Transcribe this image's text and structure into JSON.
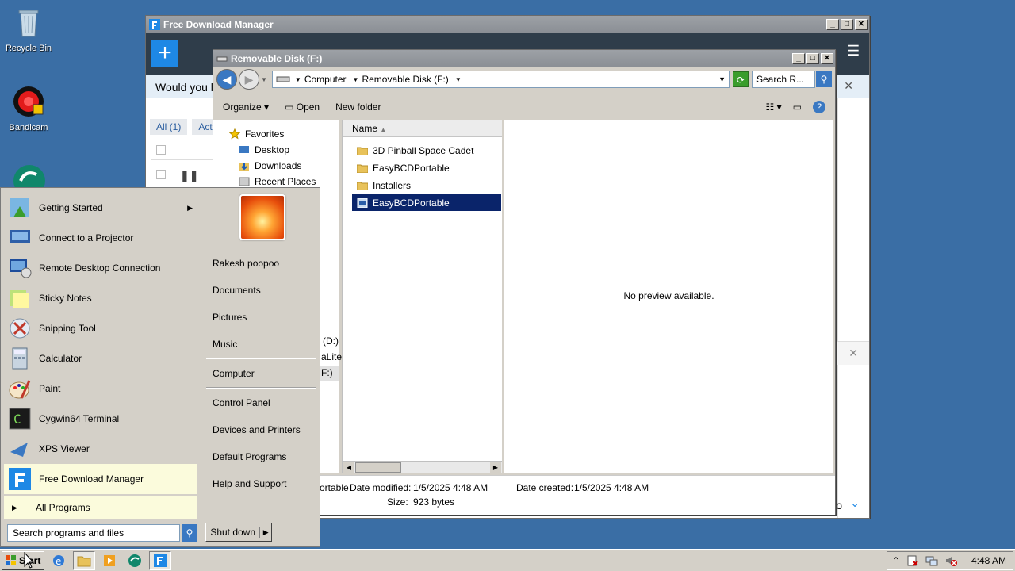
{
  "desktop": {
    "icons": [
      {
        "label": "Recycle Bin",
        "icon": "recycle-bin-icon"
      },
      {
        "label": "Bandicam",
        "icon": "bandicam-icon"
      }
    ]
  },
  "fdm": {
    "title": "Free Download Manager",
    "banner_text": "Would you l",
    "tabs": [
      "All (1)",
      "Act"
    ],
    "add_button": "+",
    "close_banner": "✕",
    "bottom_close": "✕",
    "bottom_text": "o",
    "expand": "⌄",
    "partial_right": "l"
  },
  "explorer": {
    "title": "Removable Disk (F:)",
    "address": [
      "Computer",
      "Removable Disk (F:)"
    ],
    "search_placeholder": "Search R...",
    "commands": {
      "organize": "Organize",
      "open": "Open",
      "new_folder": "New folder"
    },
    "nav": {
      "favorites": "Favorites",
      "items": [
        "Desktop",
        "Downloads",
        "Recent Places"
      ],
      "partial_drives": [
        "(D:)",
        "aLite",
        "F:)"
      ]
    },
    "list_header": "Name",
    "files": [
      {
        "name": "3D Pinball Space Cadet",
        "type": "folder",
        "selected": false
      },
      {
        "name": "EasyBCDPortable",
        "type": "folder",
        "selected": false
      },
      {
        "name": "Installers",
        "type": "folder",
        "selected": false
      },
      {
        "name": "EasyBCDPortable",
        "type": "app",
        "selected": true
      }
    ],
    "preview_msg": "No preview available.",
    "details": {
      "name_partial": "ortable",
      "date_modified_label": "Date modified:",
      "date_modified": "1/5/2025 4:48 AM",
      "date_created_label": "Date created:",
      "date_created": "1/5/2025 4:48 AM",
      "size_label": "Size:",
      "size": "923 bytes"
    }
  },
  "startmenu": {
    "programs": [
      {
        "label": "Getting Started",
        "icon": "getting-started-icon",
        "submenu": true
      },
      {
        "label": "Connect to a Projector",
        "icon": "projector-icon"
      },
      {
        "label": "Remote Desktop Connection",
        "icon": "remote-desktop-icon"
      },
      {
        "label": "Sticky Notes",
        "icon": "sticky-notes-icon"
      },
      {
        "label": "Snipping Tool",
        "icon": "snipping-tool-icon"
      },
      {
        "label": "Calculator",
        "icon": "calculator-icon"
      },
      {
        "label": "Paint",
        "icon": "paint-icon"
      },
      {
        "label": "Cygwin64 Terminal",
        "icon": "terminal-icon"
      },
      {
        "label": "XPS Viewer",
        "icon": "xps-viewer-icon"
      },
      {
        "label": "Free Download Manager",
        "icon": "fdm-icon",
        "highlighted": true
      }
    ],
    "all_programs": "All Programs",
    "search_placeholder": "Search programs and files",
    "user": "Rakesh poopoo",
    "links_group1": [
      "Documents",
      "Pictures",
      "Music"
    ],
    "links_group2": [
      "Computer"
    ],
    "links_group3": [
      "Control Panel",
      "Devices and Printers",
      "Default Programs",
      "Help and Support"
    ],
    "shutdown": "Shut down"
  },
  "taskbar": {
    "start": "Start",
    "clock": "4:48 AM"
  }
}
